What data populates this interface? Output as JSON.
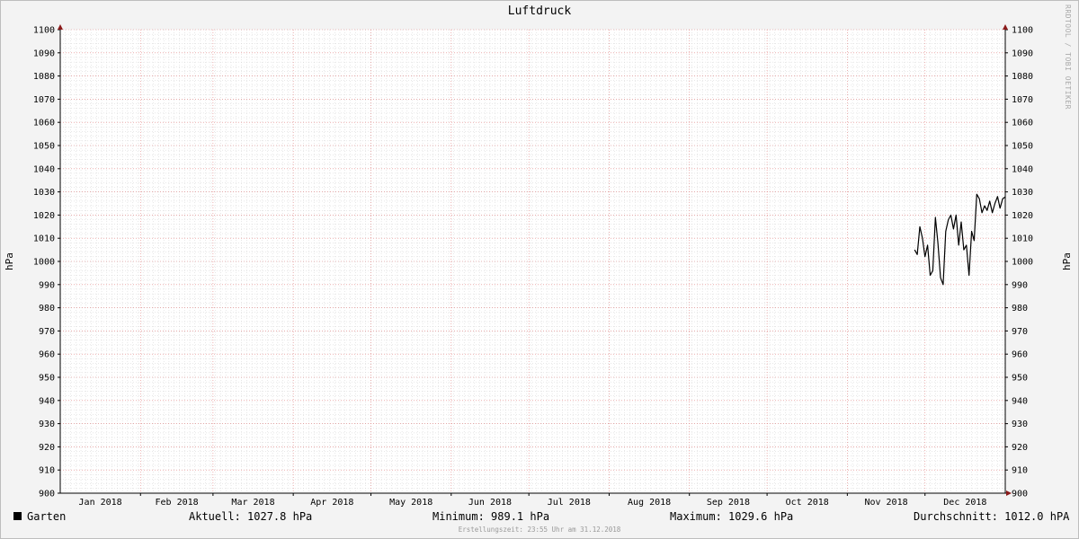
{
  "chart_data": {
    "type": "line",
    "title": "Luftdruck",
    "ylabel_left": "hPa",
    "ylabel_right": "hPa",
    "ylim": [
      900,
      1100
    ],
    "y_ticks": [
      900,
      910,
      920,
      930,
      940,
      950,
      960,
      970,
      980,
      990,
      1000,
      1010,
      1020,
      1030,
      1040,
      1050,
      1060,
      1070,
      1080,
      1090,
      1100
    ],
    "x_range_days": [
      0,
      365
    ],
    "x_tick_labels": [
      "Jan 2018",
      "Feb 2018",
      "Mar 2018",
      "Apr 2018",
      "May 2018",
      "Jun 2018",
      "Jul 2018",
      "Aug 2018",
      "Sep 2018",
      "Oct 2018",
      "Nov 2018",
      "Dec 2018"
    ],
    "month_starts_day": [
      0,
      31,
      59,
      90,
      120,
      151,
      181,
      212,
      243,
      273,
      304,
      334
    ],
    "grid": true,
    "colors": {
      "background": "#f3f3f3",
      "plot_background": "#ffffff",
      "minor_grid": "#d0d0d0",
      "major_grid": "#e08080",
      "line": "#000000"
    },
    "series": [
      {
        "name": "Garten",
        "x": [
          330,
          331,
          332,
          333,
          334,
          335,
          336,
          337,
          338,
          339,
          340,
          341,
          342,
          343,
          344,
          345,
          346,
          347,
          348,
          349,
          350,
          351,
          352,
          353,
          354,
          355,
          356,
          357,
          358,
          359,
          360,
          361,
          362,
          363,
          364,
          365
        ],
        "values": [
          1005,
          1003,
          1015,
          1010,
          1002,
          1007,
          994,
          996,
          1019,
          1008,
          993,
          990,
          1013,
          1018,
          1020,
          1014,
          1020,
          1007,
          1017,
          1005,
          1007,
          994,
          1013,
          1009,
          1029,
          1027,
          1021,
          1024,
          1022,
          1026,
          1021,
          1025,
          1028,
          1023,
          1027,
          1027.8
        ]
      }
    ]
  },
  "legend": {
    "series_name": "Garten",
    "aktuell": "Aktuell: 1027.8 hPa",
    "minimum": "Minimum: 989.1 hPa",
    "maximum": "Maximum: 1029.6 hPa",
    "durchschnitt": "Durchschnitt: 1012.0 hPA"
  },
  "watermark": "RRDTOOL / TOBI OETIKER",
  "footer": "Erstellungszeit: 23:55 Uhr am 31.12.2018"
}
